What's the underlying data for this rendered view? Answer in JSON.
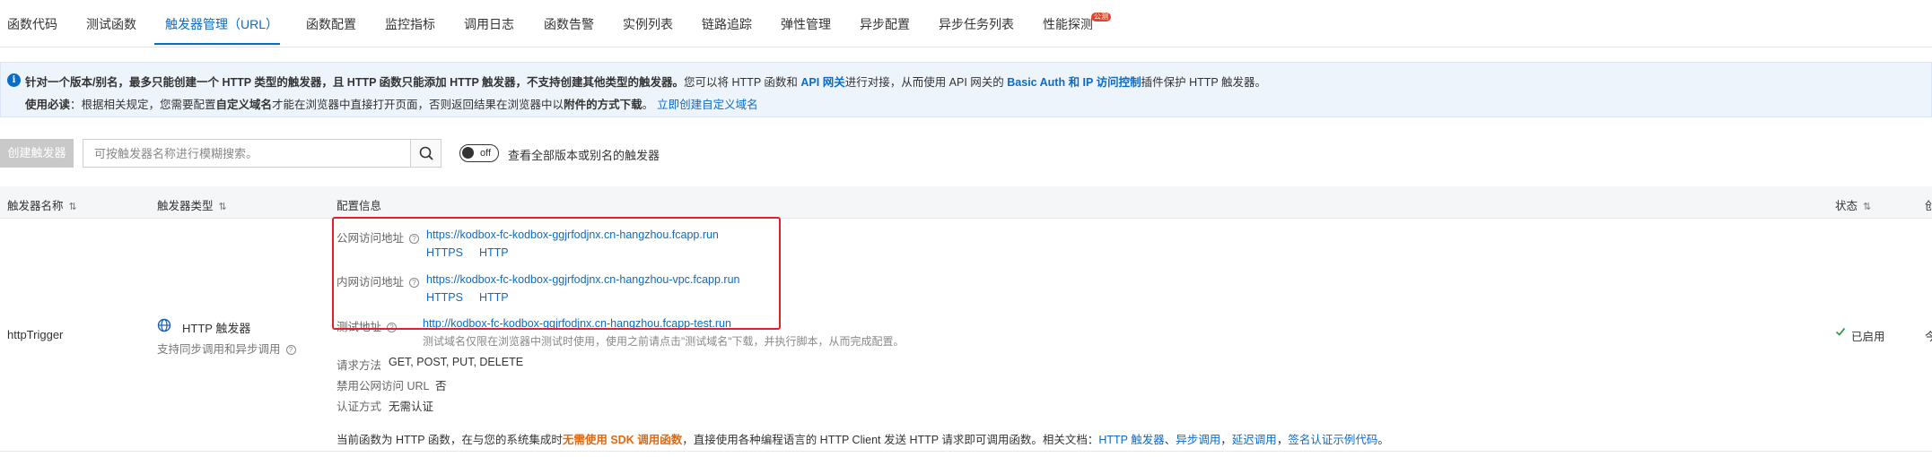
{
  "tabs": [
    {
      "label": "函数代码"
    },
    {
      "label": "测试函数"
    },
    {
      "label": "触发器管理（URL）",
      "active": true
    },
    {
      "label": "函数配置"
    },
    {
      "label": "监控指标"
    },
    {
      "label": "调用日志"
    },
    {
      "label": "函数告警"
    },
    {
      "label": "实例列表"
    },
    {
      "label": "链路追踪"
    },
    {
      "label": "弹性管理"
    },
    {
      "label": "异步配置"
    },
    {
      "label": "异步任务列表"
    },
    {
      "label": "性能探测",
      "badge": "公测"
    }
  ],
  "notice": {
    "line1": {
      "bold1": "针对一个版本/别名，最多只能创建一个 HTTP 类型的触发器，且 HTTP 函数只能添加 HTTP 触发器，不支持创建其他类型的触发器。",
      "text1": "您可以将 HTTP 函数和 ",
      "link1": "API 网关",
      "text2": "进行对接，从而使用 API 网关的 ",
      "link2": "Basic Auth 和 IP 访问控制",
      "text3": "插件保护 HTTP 触发器。"
    },
    "line2": {
      "bold1": "使用必读",
      "text1": "：根据相关规定，您需要配置",
      "bold2": "自定义域名",
      "text2": "才能在浏览器中直接打开页面，否则返回结果在浏览器中以",
      "bold3": "附件的方式下载",
      "text3": "。",
      "link1": "立即创建自定义域名"
    }
  },
  "toolbar": {
    "create_label": "创建触发器",
    "search_placeholder": "可按触发器名称进行模糊搜索。",
    "toggle_text": "off",
    "toggle_label": "查看全部版本或别名的触发器"
  },
  "table": {
    "headers": {
      "name": "触发器名称",
      "type": "触发器类型",
      "config": "配置信息",
      "status": "状态",
      "extra": "创"
    },
    "row": {
      "name": "httpTrigger",
      "type_label": "HTTP 触发器",
      "type_sub": "支持同步调用和异步调用",
      "public_label": "公网访问地址",
      "public_url": "https://kodbox-fc-kodbox-ggjrfodjnx.cn-hangzhou.fcapp.run",
      "internal_label": "内网访问地址",
      "internal_url": "https://kodbox-fc-kodbox-ggjrfodjnx.cn-hangzhou-vpc.fcapp.run",
      "proto_https": "HTTPS",
      "proto_http": "HTTP",
      "test_label": "测试地址",
      "test_url": "http://kodbox-fc-kodbox-ggjrfodjnx.cn-hangzhou.fcapp-test.run",
      "test_note": "测试域名仅限在浏览器中测试时使用，使用之前请点击\"测试域名\"下载，并执行脚本，从而完成配置。",
      "method_label": "请求方法",
      "method_value": "GET, POST, PUT, DELETE",
      "disable_label": "禁用公网访问 URL",
      "disable_value": "否",
      "auth_label": "认证方式",
      "auth_value": "无需认证",
      "footer": {
        "text1": "当前函数为 HTTP 函数，在与您的系统集成时",
        "orange": "无需使用 SDK 调用函数",
        "text2": "，直接使用各种编程语言的 HTTP Client 发送 HTTP 请求即可调用函数。相关文档：",
        "link1": "HTTP 触发器",
        "sep1": "、",
        "link2": "异步调用",
        "sep2": "，",
        "link3": "延迟调用",
        "sep3": "，",
        "link4": "签名认证示例代码",
        "end": "。"
      },
      "status": "已启用",
      "extra": "今"
    }
  },
  "colors": {
    "accent": "#0b6cc6",
    "highlight_box": "#e0202a",
    "status_ok": "#2ea043",
    "emphasis": "#e06a10"
  }
}
